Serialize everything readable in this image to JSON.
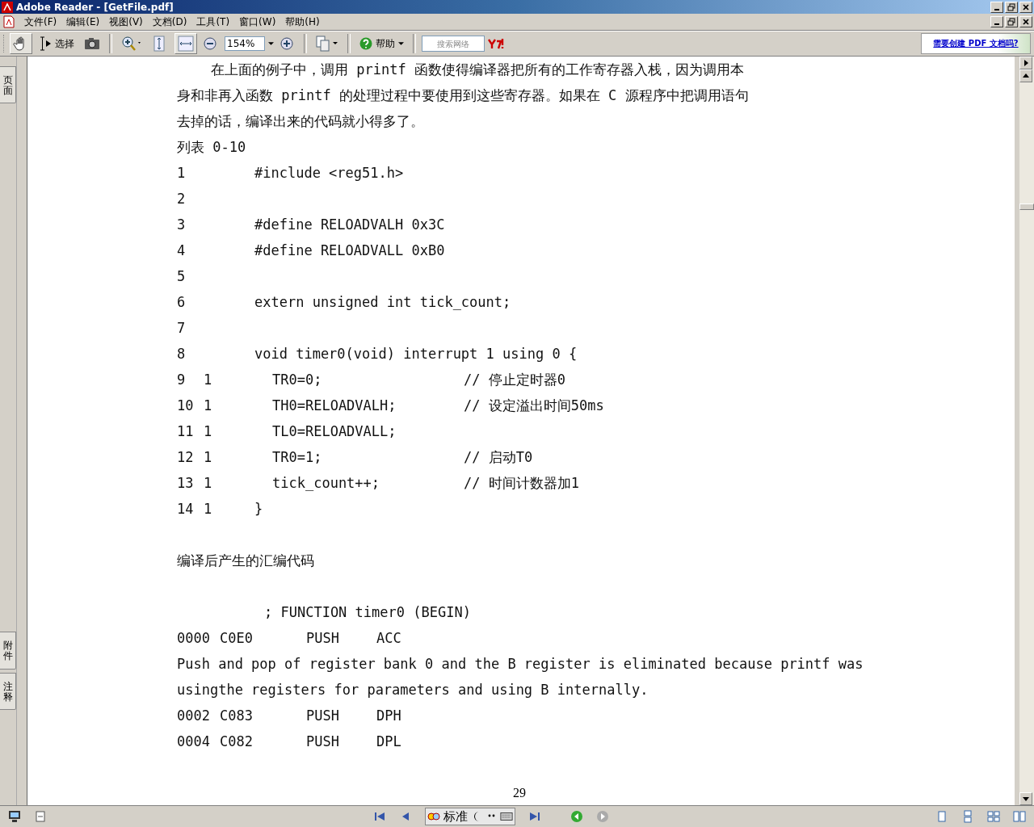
{
  "window": {
    "title": "Adobe Reader - [GetFile.pdf]"
  },
  "menu": [
    "文件(F)",
    "编辑(E)",
    "视图(V)",
    "文档(D)",
    "工具(T)",
    "窗口(W)",
    "帮助(H)"
  ],
  "toolbar": {
    "select_label": "选择",
    "zoom": "154%",
    "help_label": "帮助",
    "search_placeholder": "搜索网络",
    "promo_link": "需要创建 PDF 文档吗?"
  },
  "side_tabs": [
    {
      "label": "页面",
      "selected": false
    },
    {
      "label": "附件",
      "selected": false
    },
    {
      "label": "注释",
      "selected": false
    }
  ],
  "document": {
    "page_number": "29",
    "lines": [
      {
        "kind": "text",
        "text": "在上面的例子中，调用 printf 函数使得编译器把所有的工作寄存器入栈，因为调用本",
        "indent": true
      },
      {
        "kind": "text",
        "text": "身和非再入函数 printf 的处理过程中要使用到这些寄存器。如果在 C 源程序中把调用语句"
      },
      {
        "kind": "text",
        "text": "去掉的话，编译出来的代码就小得多了。"
      },
      {
        "kind": "text",
        "text": "列表 0-10"
      },
      {
        "kind": "code",
        "num": "1",
        "code": "#include <reg51.h>"
      },
      {
        "kind": "code",
        "num": "2"
      },
      {
        "kind": "code",
        "num": "3",
        "code": "#define RELOADVALH 0x3C"
      },
      {
        "kind": "code",
        "num": "4",
        "code": "#define RELOADVALL 0xB0"
      },
      {
        "kind": "code",
        "num": "5"
      },
      {
        "kind": "code",
        "num": "6",
        "code": "extern unsigned int tick_count;"
      },
      {
        "kind": "code",
        "num": "7"
      },
      {
        "kind": "code",
        "num": "8",
        "code": "void timer0(void) interrupt 1 using 0 {"
      },
      {
        "kind": "code",
        "num": "9",
        "nest": "1",
        "code": "TR0=0;",
        "comment": "// 停止定时器0"
      },
      {
        "kind": "code",
        "num": "10",
        "nest": "1",
        "code": "TH0=RELOADVALH;",
        "comment": "// 设定溢出时间50ms"
      },
      {
        "kind": "code",
        "num": "11",
        "nest": "1",
        "code": "TL0=RELOADVALL;"
      },
      {
        "kind": "code",
        "num": "12",
        "nest": "1",
        "code": "TR0=1;",
        "comment": "// 启动T0"
      },
      {
        "kind": "code",
        "num": "13",
        "nest": "1",
        "code": "tick_count++;",
        "comment": "// 时间计数器加1"
      },
      {
        "kind": "code",
        "num": "14",
        "nest": "1",
        "code": "}",
        "close": true
      },
      {
        "kind": "blank"
      },
      {
        "kind": "text",
        "text": "编译后产生的汇编代码"
      },
      {
        "kind": "blank"
      },
      {
        "kind": "label",
        "text": "; FUNCTION timer0 (BEGIN)"
      },
      {
        "kind": "asm",
        "addr": "0000",
        "opcode": "C0E0",
        "op": "PUSH",
        "arg": "ACC"
      },
      {
        "kind": "text",
        "text": "Push and pop of register bank 0 and the B register is eliminated because printf was"
      },
      {
        "kind": "text",
        "text": "usingthe registers for parameters and using B internally."
      },
      {
        "kind": "asm",
        "addr": "0002",
        "opcode": "C083",
        "op": "PUSH",
        "arg": "DPH"
      },
      {
        "kind": "asm",
        "addr": "0004",
        "opcode": "C082",
        "op": "PUSH",
        "arg": "DPL"
      }
    ]
  },
  "ime": {
    "mode": "标准"
  }
}
